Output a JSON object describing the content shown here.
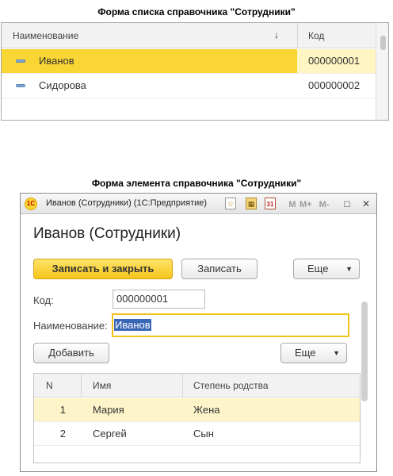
{
  "captions": {
    "list_form": "Форма списка справочника \"Сотрудники\"",
    "element_form": "Форма элемента справочника \"Сотрудники\""
  },
  "list": {
    "columns": {
      "name": "Наименование",
      "sort_indicator": "↓",
      "code": "Код"
    },
    "rows": [
      {
        "name": "Иванов",
        "code": "000000001",
        "selected": true
      },
      {
        "name": "Сидорова",
        "code": "000000002",
        "selected": false
      }
    ]
  },
  "window": {
    "title": "Иванов (Сотрудники)  (1С:Предприятие)",
    "logo_text": "1С",
    "toolbar": {
      "calendar_day": "31",
      "m": "M",
      "m_plus": "M+",
      "m_minus": "M-"
    },
    "controls": {
      "restore": "□",
      "close": "✕"
    }
  },
  "form": {
    "title": "Иванов (Сотрудники)",
    "buttons": {
      "write_close": "Записать и закрыть",
      "write": "Записать",
      "more": "Еще",
      "add": "Добавить"
    },
    "fields": {
      "code_label": "Код:",
      "code_value": "000000001",
      "name_label": "Наименование:",
      "name_value": "Иванов"
    },
    "table": {
      "columns": {
        "n": "N",
        "name": "Имя",
        "relation": "Степень родства"
      },
      "rows": [
        {
          "n": "1",
          "name": "Мария",
          "relation": "Жена",
          "selected": true
        },
        {
          "n": "2",
          "name": "Сергей",
          "relation": "Сын",
          "selected": false
        }
      ]
    }
  },
  "colors": {
    "accent_yellow": "#fad634",
    "selection_blue": "#3a66b6",
    "row_highlight": "#fdf5c9"
  },
  "icons": [
    "element-icon",
    "favorite-icon",
    "calculator-icon",
    "calendar-icon",
    "restore-icon",
    "close-icon",
    "dropdown-arrow-icon",
    "sort-arrow-icon"
  ]
}
